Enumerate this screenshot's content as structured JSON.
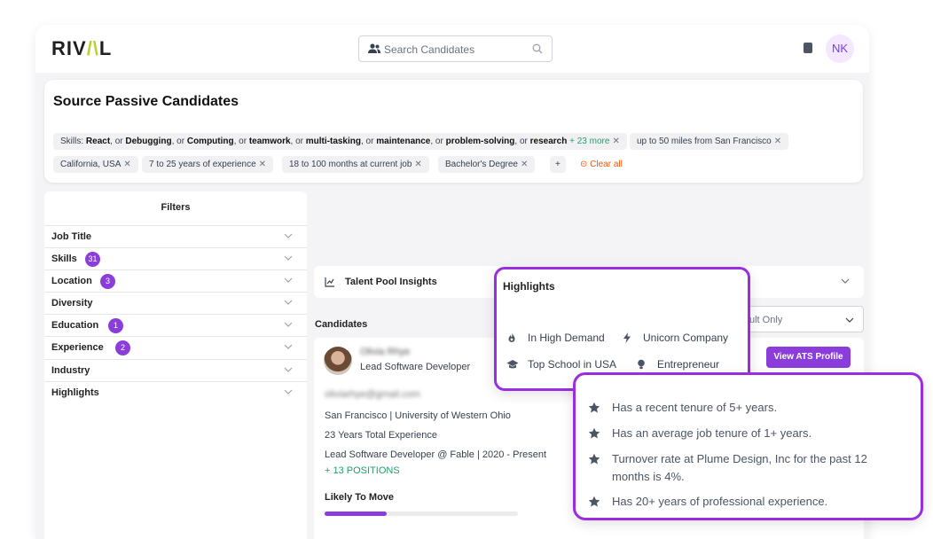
{
  "app": {
    "logo": "RIV",
    "logo_accent": "/\\",
    "logo_end": "L"
  },
  "search": {
    "placeholder": "Search Candidates"
  },
  "user": {
    "initials": "NK"
  },
  "source": {
    "title": "Source Passive Candidates",
    "skills_prefix": "Skills: ",
    "skills": [
      "React",
      "Debugging",
      "Computing",
      "teamwork",
      "multi-tasking",
      "maintenance",
      "problem-solving",
      "research"
    ],
    "skills_joiner": ", or ",
    "skills_more": "+ 23 more",
    "chips": [
      "up to 50 miles from San Francisco",
      "California, USA",
      "7 to 25 years of experience",
      "18 to 100 months at current job",
      "Bachelor's Degree"
    ],
    "add": "+",
    "clear_all": "Clear all"
  },
  "filters": {
    "title": "Filters",
    "items": [
      {
        "label": "Job Title",
        "count": ""
      },
      {
        "label": "Skills",
        "count": "31"
      },
      {
        "label": "Location",
        "count": "3"
      },
      {
        "label": "Diversity",
        "count": ""
      },
      {
        "label": "Education",
        "count": "1"
      },
      {
        "label": "Experience",
        "count": "2"
      },
      {
        "label": "Industry",
        "count": ""
      },
      {
        "label": "Highlights",
        "count": ""
      }
    ]
  },
  "insights": {
    "title": "Talent Pool Insights"
  },
  "candidates": {
    "label": "Candidates",
    "result_filter": "ult Only",
    "card": {
      "name": "Olivia Rhye",
      "role": "Lead Software Developer",
      "email": "oliviarhye@gmail.com",
      "location_school": "San Francisco | University of Western Ohio",
      "experience": "23 Years Total Experience",
      "current": "Lead Software Developer @ Fable | 2020 - Present",
      "positions": "+ 13 POSITIONS",
      "likely_label": "Likely To Move",
      "likely_value": 0.32,
      "ats_button": "View ATS Profile"
    }
  },
  "highlights_card": {
    "title": "Highlights",
    "items": [
      {
        "label": "In High Demand",
        "icon": "flame-icon"
      },
      {
        "label": "Unicorn Company",
        "icon": "bolt-icon"
      },
      {
        "label": "Top School in USA",
        "icon": "graduation-cap-icon"
      },
      {
        "label": "Entrepreneur",
        "icon": "lightbulb-icon"
      }
    ]
  },
  "tenure_card": {
    "items": [
      "Has a recent tenure of 5+ years.",
      "Has an average job tenure of 1+ years.",
      "Turnover rate at Plume Design, Inc for the past 12 months is 4%.",
      "Has 20+ years of professional experience."
    ]
  },
  "colors": {
    "accent": "#8b3ddb",
    "border_highlight": "#9b2de0",
    "positive": "#22a06b",
    "clear": "#ea580c"
  }
}
